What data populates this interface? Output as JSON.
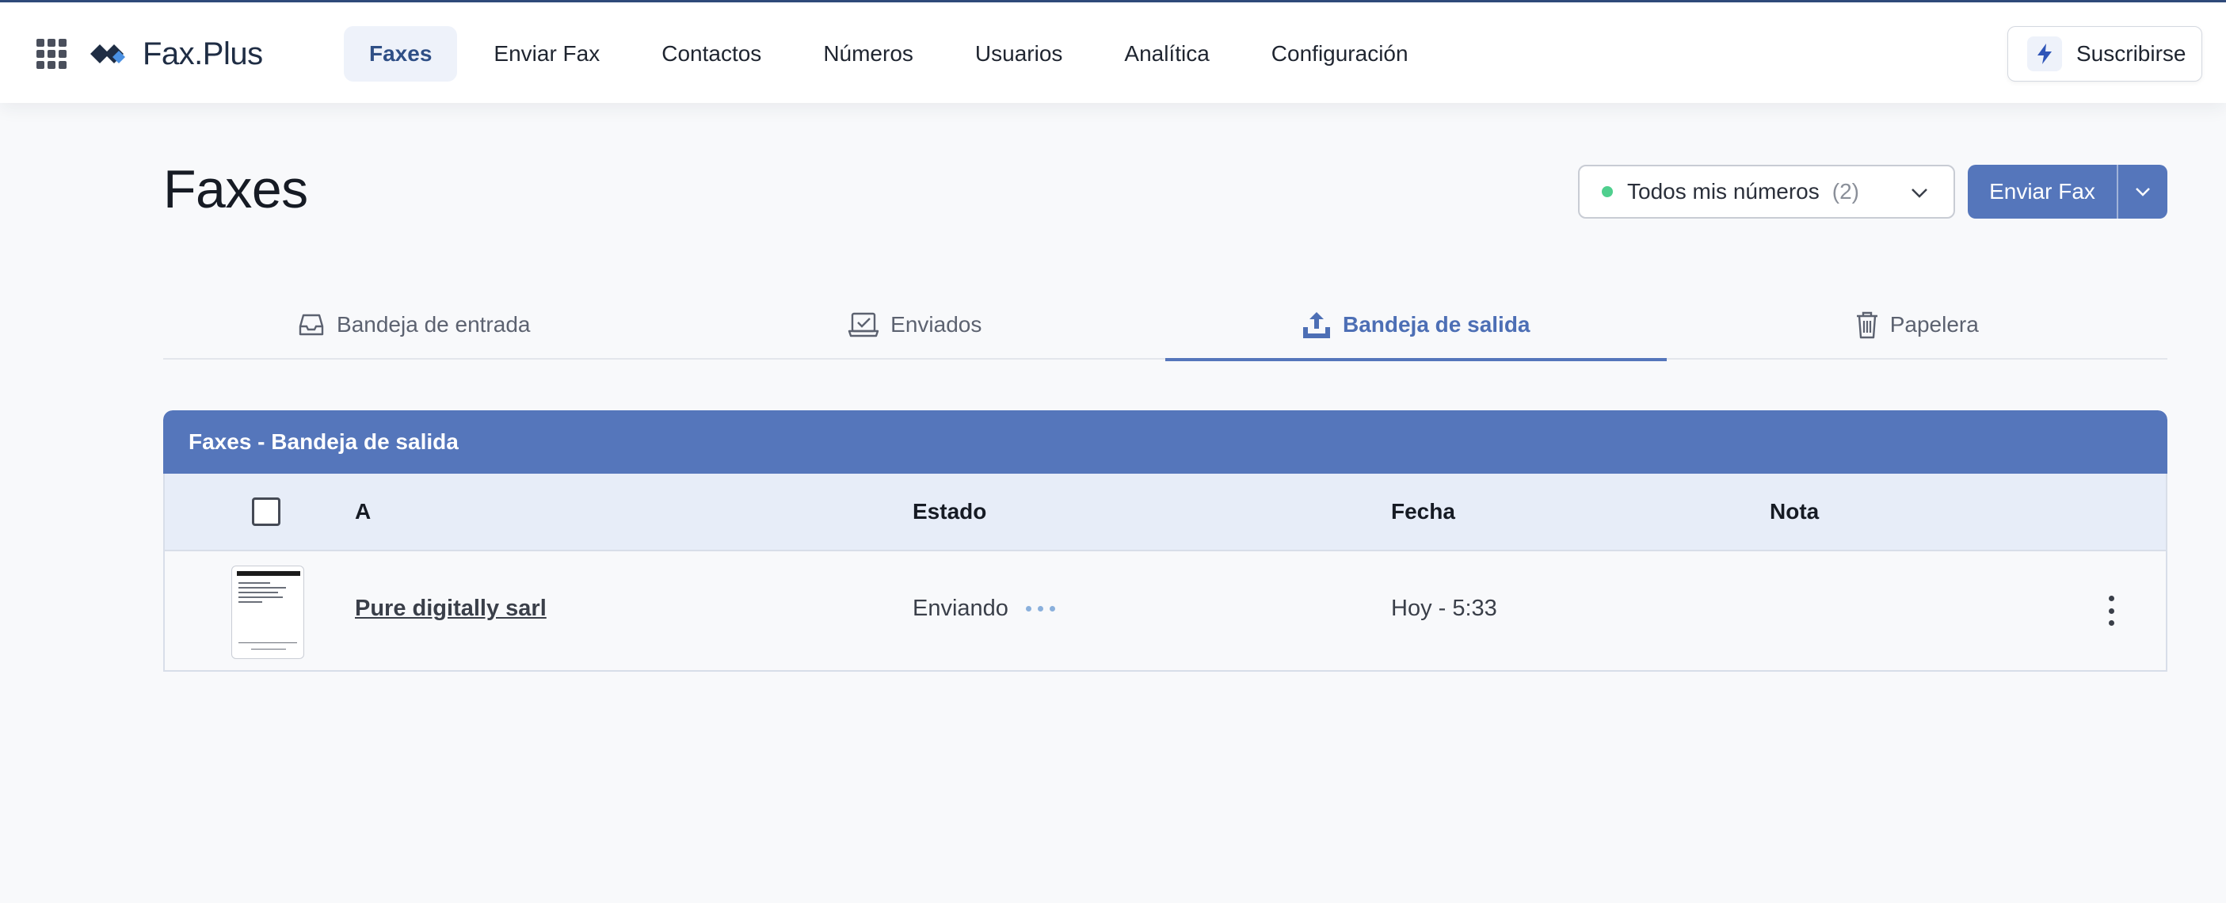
{
  "app": {
    "brand": "Fax.Plus",
    "nav": [
      {
        "label": "Faxes",
        "active": true
      },
      {
        "label": "Enviar Fax"
      },
      {
        "label": "Contactos"
      },
      {
        "label": "Números"
      },
      {
        "label": "Usuarios"
      },
      {
        "label": "Analítica"
      },
      {
        "label": "Configuración"
      }
    ],
    "subscribe_label": "Suscribirse",
    "icons": {
      "apps": "grid-apps-icon",
      "subscribe": "bolt-icon"
    }
  },
  "header": {
    "title": "Faxes",
    "number_filter": {
      "label": "Todos mis números",
      "count": "(2)",
      "status_color": "#4fcf8e"
    },
    "send_button_label": "Enviar Fax"
  },
  "tabs": [
    {
      "label": "Bandeja de entrada",
      "icon": "inbox-icon"
    },
    {
      "label": "Enviados",
      "icon": "sent-check-icon"
    },
    {
      "label": "Bandeja de salida",
      "icon": "upload-tray-icon",
      "active": true
    },
    {
      "label": "Papelera",
      "icon": "trash-icon"
    }
  ],
  "table": {
    "title": "Faxes - Bandeja de salida",
    "columns": [
      "A",
      "Estado",
      "Fecha",
      "Nota"
    ],
    "rows": [
      {
        "to": "Pure digitally sarl",
        "status": "Enviando",
        "date": "Hoy - 5:33",
        "note": ""
      }
    ]
  },
  "colors": {
    "accent": "#5576bb",
    "nav_active_bg": "#eef2fa",
    "table_header_bg": "#e7edf8"
  }
}
